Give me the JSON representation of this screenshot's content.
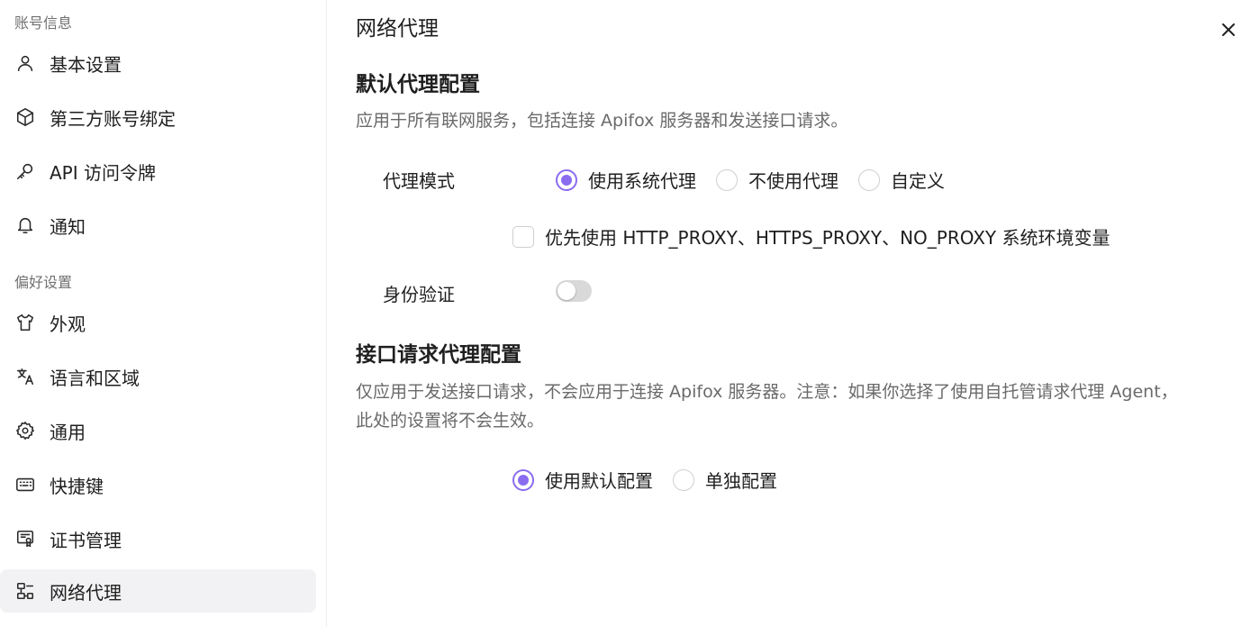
{
  "sidebar": {
    "groups": [
      {
        "title": "账号信息"
      },
      {
        "title": "偏好设置"
      }
    ],
    "items": [
      {
        "label": "基本设置",
        "icon": "user-icon"
      },
      {
        "label": "第三方账号绑定",
        "icon": "cube-icon"
      },
      {
        "label": "API 访问令牌",
        "icon": "key-icon"
      },
      {
        "label": "通知",
        "icon": "bell-icon"
      },
      {
        "label": "外观",
        "icon": "shirt-icon"
      },
      {
        "label": "语言和区域",
        "icon": "translate-icon"
      },
      {
        "label": "通用",
        "icon": "gear-icon"
      },
      {
        "label": "快捷键",
        "icon": "keyboard-icon"
      },
      {
        "label": "证书管理",
        "icon": "certificate-icon"
      },
      {
        "label": "网络代理",
        "icon": "network-icon",
        "active": true
      }
    ]
  },
  "main": {
    "title": "网络代理",
    "default_proxy": {
      "title": "默认代理配置",
      "description": "应用于所有联网服务，包括连接 Apifox 服务器和发送接口请求。",
      "mode_label": "代理模式",
      "mode_options": [
        "使用系统代理",
        "不使用代理",
        "自定义"
      ],
      "mode_selected": "使用系统代理",
      "env_checkbox_label": "优先使用 HTTP_PROXY、HTTPS_PROXY、NO_PROXY 系统环境变量",
      "env_checkbox_checked": false,
      "auth_label": "身份验证",
      "auth_enabled": false
    },
    "request_proxy": {
      "title": "接口请求代理配置",
      "description_line1": "仅应用于发送接口请求，不会应用于连接 Apifox 服务器。注意：如果你选择了使用自托管请求代理 Agent，",
      "description_line2": "此处的设置将不会生效。",
      "options": [
        "使用默认配置",
        "单独配置"
      ],
      "selected": "使用默认配置"
    }
  },
  "colors": {
    "accent": "#8a6cf0",
    "active_bg": "#f2f2f4",
    "muted_text": "#6a6a6a"
  }
}
